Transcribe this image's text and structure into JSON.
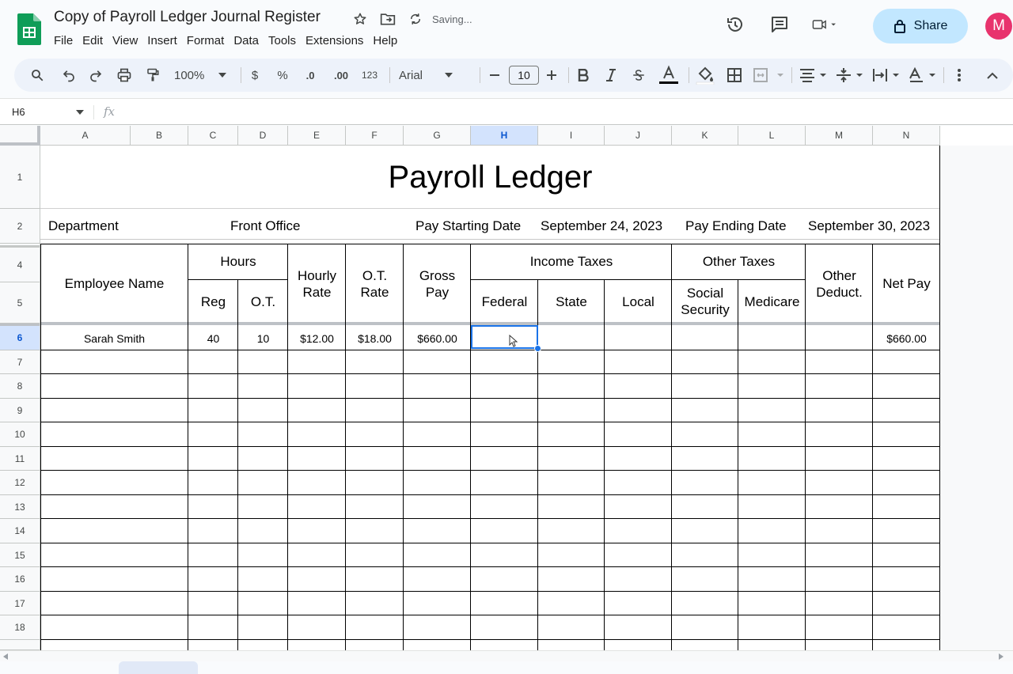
{
  "app": {
    "doc_title": "Copy of Payroll Ledger Journal Register",
    "saving_status": "Saving...",
    "menu": [
      "File",
      "Edit",
      "View",
      "Insert",
      "Format",
      "Data",
      "Tools",
      "Extensions",
      "Help"
    ],
    "share_label": "Share",
    "avatar_initial": "M",
    "brand_color": "#0f9d58",
    "accent_color": "#0b57d0"
  },
  "toolbar": {
    "zoom": "100%",
    "currency": "$",
    "percent": "%",
    "decrease_decimal": ".0",
    "increase_decimal": ".00",
    "number_format": "123",
    "font": "Arial",
    "font_size": "10"
  },
  "formula_bar": {
    "cell_ref": "H6",
    "fx": "fx",
    "value": ""
  },
  "columns": [
    "A",
    "B",
    "C",
    "D",
    "E",
    "F",
    "G",
    "H",
    "I",
    "J",
    "K",
    "L",
    "M",
    "N"
  ],
  "selected_column": "H",
  "rows": [
    "1",
    "2",
    "4",
    "5",
    "6",
    "7",
    "8",
    "9",
    "10",
    "11",
    "12",
    "13",
    "14",
    "15",
    "16",
    "17",
    "18"
  ],
  "selected_row": "6",
  "sheet": {
    "title": "Payroll Ledger",
    "department_label": "Department",
    "department_value": "Front Office",
    "pay_start_label": "Pay Starting Date",
    "pay_start_value": "September 24, 2023",
    "pay_end_label": "Pay Ending Date",
    "pay_end_value": "September 30, 2023",
    "headers": {
      "employee_name": "Employee Name",
      "hours": "Hours",
      "reg": "Reg",
      "ot": "O.T.",
      "hourly_rate": "Hourly Rate",
      "ot_rate": "O.T. Rate",
      "gross_pay": "Gross Pay",
      "income_taxes": "Income Taxes",
      "federal": "Federal",
      "state": "State",
      "local": "Local",
      "other_taxes": "Other Taxes",
      "social_security": "Social Security",
      "medicare": "Medicare",
      "other_deduct": "Other Deduct.",
      "net_pay": "Net Pay"
    },
    "entries": [
      {
        "name": "Sarah Smith",
        "reg": "40",
        "ot": "10",
        "hourly_rate": "$12.00",
        "ot_rate": "$18.00",
        "gross_pay": "$660.00",
        "federal": "",
        "state": "",
        "local": "",
        "social_security": "",
        "medicare": "",
        "other_deduct": "",
        "net_pay": "$660.00"
      }
    ]
  }
}
